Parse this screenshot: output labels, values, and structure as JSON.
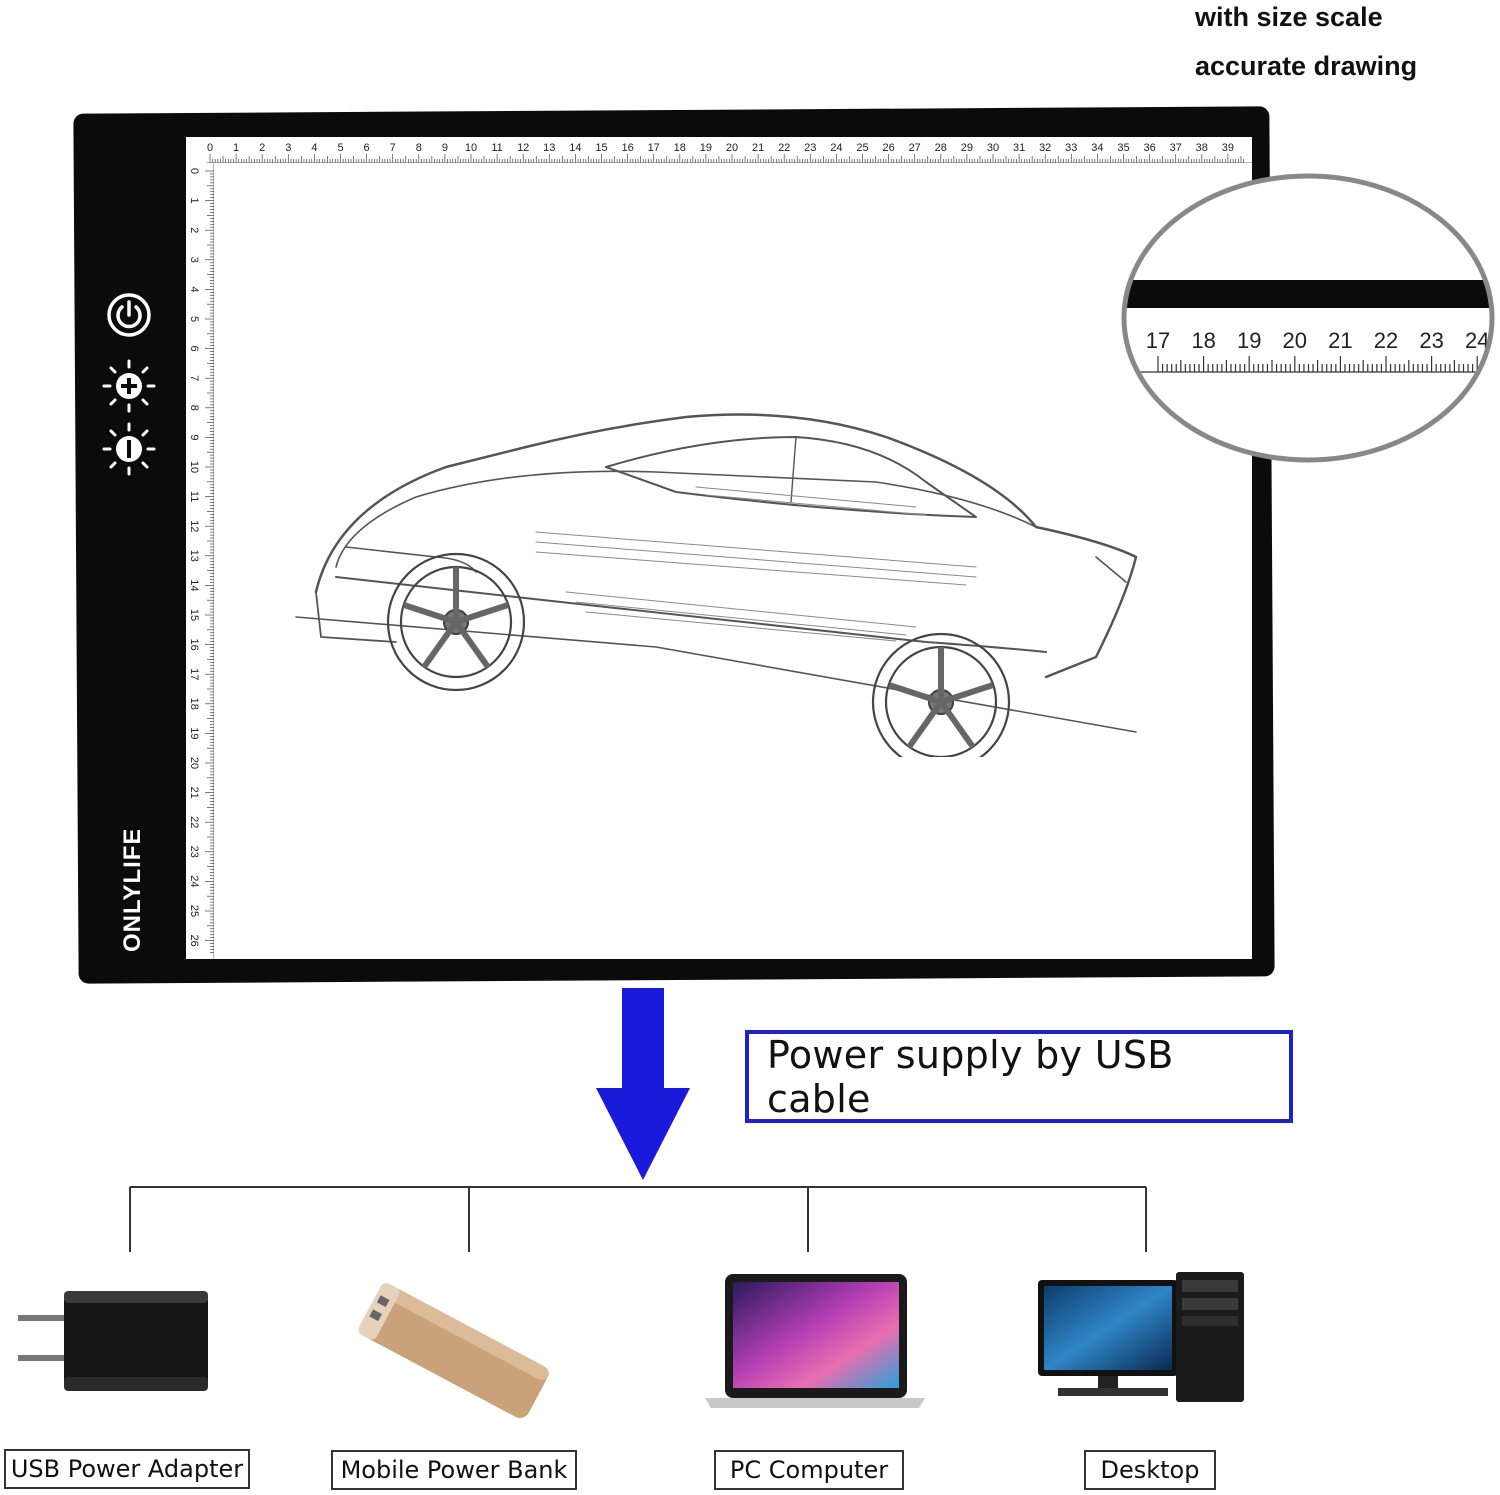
{
  "header": {
    "line1": "with size scale",
    "line2": "accurate drawing"
  },
  "light_pad": {
    "brand": "ONLYLIFE",
    "controls": [
      {
        "name": "power-icon"
      },
      {
        "name": "brightness-up-icon"
      },
      {
        "name": "brightness-down-icon"
      }
    ],
    "ruler_top_labels": [
      "0",
      "1",
      "2",
      "3",
      "4",
      "5",
      "6",
      "7",
      "8",
      "9",
      "10",
      "11",
      "12",
      "13",
      "14",
      "15",
      "16",
      "17",
      "18",
      "19",
      "20",
      "21",
      "22",
      "23",
      "24",
      "25",
      "26",
      "27",
      "28",
      "29",
      "30",
      "31",
      "32",
      "33",
      "34",
      "35",
      "36",
      "37",
      "38",
      "39"
    ],
    "ruler_left_labels": [
      "0",
      "1",
      "2",
      "3",
      "4",
      "5",
      "6",
      "7",
      "8",
      "9",
      "10",
      "11",
      "12",
      "13",
      "14",
      "15",
      "16",
      "17",
      "18",
      "19",
      "20",
      "21",
      "22",
      "23",
      "24",
      "25",
      "26"
    ],
    "zoom_labels": [
      "17",
      "18",
      "19",
      "20",
      "21",
      "22",
      "23",
      "24"
    ]
  },
  "power_supply": {
    "label": "Power supply by USB cable",
    "accent": "#1a1adb"
  },
  "sources": [
    {
      "label": "USB Power Adapter",
      "icon": "usb-adapter-icon"
    },
    {
      "label": "Mobile Power Bank",
      "icon": "power-bank-icon"
    },
    {
      "label": "PC Computer",
      "icon": "laptop-icon"
    },
    {
      "label": "Desktop",
      "icon": "desktop-computer-icon"
    }
  ]
}
